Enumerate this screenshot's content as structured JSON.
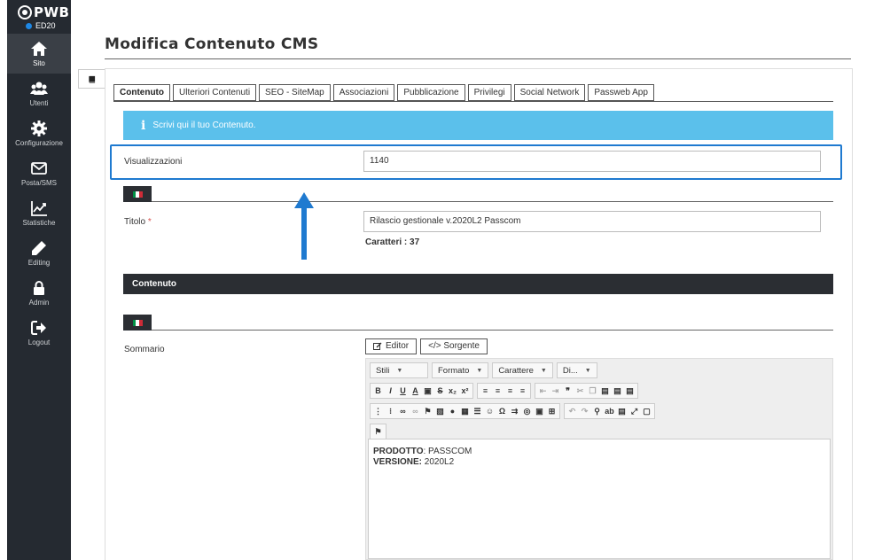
{
  "brand": {
    "name": "PWB",
    "env": "ED20"
  },
  "sidebar": {
    "items": [
      {
        "id": "sito",
        "label": "Sito",
        "icon": "home-icon",
        "active": true
      },
      {
        "id": "utenti",
        "label": "Utenti",
        "icon": "users-icon",
        "active": false
      },
      {
        "id": "configurazione",
        "label": "Configurazione",
        "icon": "gear-icon",
        "active": false
      },
      {
        "id": "posta",
        "label": "Posta/SMS",
        "icon": "envelope-icon",
        "active": false
      },
      {
        "id": "statistiche",
        "label": "Statistiche",
        "icon": "chart-icon",
        "active": false
      },
      {
        "id": "editing",
        "label": "Editing",
        "icon": "pencil-icon",
        "active": false
      },
      {
        "id": "admin",
        "label": "Admin",
        "icon": "lock-icon",
        "active": false
      },
      {
        "id": "logout",
        "label": "Logout",
        "icon": "logout-icon",
        "active": false
      }
    ]
  },
  "page": {
    "title": "Modifica Contenuto CMS"
  },
  "tabs": [
    "Contenuto",
    "Ulteriori Contenuti",
    "SEO - SiteMap",
    "Associazioni",
    "Pubblicazione",
    "Privilegi",
    "Social Network",
    "Passweb App"
  ],
  "info": {
    "icon": "info-icon",
    "text": "Scrivi qui il tuo Contenuto."
  },
  "fields": {
    "visualizzazioni": {
      "label": "Visualizzazioni",
      "value": "1140"
    },
    "titolo": {
      "label": "Titolo",
      "required_mark": "*",
      "value": "Rilascio gestionale v.2020L2 Passcom",
      "counter": "Caratteri : 37"
    },
    "sommario": {
      "label": "Sommario"
    }
  },
  "sections": {
    "contenuto": "Contenuto"
  },
  "editor": {
    "mode_buttons": {
      "editor": "Editor",
      "source": "</> Sorgente"
    },
    "combos": {
      "styles": "Stili",
      "format": "Formato",
      "font": "Carattere",
      "size": "Di..."
    },
    "content": {
      "line1_label": "PRODOTTO",
      "line1_value": ": PASSCOM",
      "line2_label": "VERSIONE:",
      "line2_value": " 2020L2"
    }
  },
  "colors": {
    "sidebar": "#252a31",
    "info_bg": "#5bc0eb",
    "highlight": "#1f7ad0",
    "section_bar": "#2b2e33",
    "required": "#d9534f",
    "flag_green": "#009246",
    "flag_white": "#ffffff",
    "flag_red": "#ce2b37"
  }
}
